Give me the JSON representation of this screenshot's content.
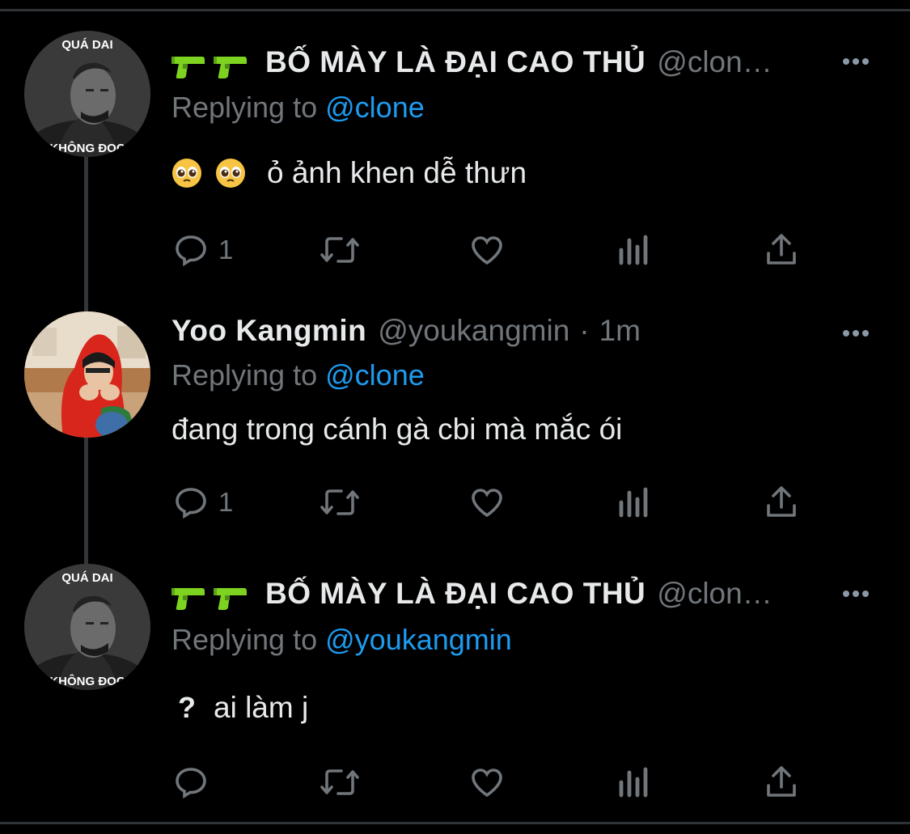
{
  "tweets": [
    {
      "author_name": "BỐ MÀY LÀ ĐẠI CAO THỦ",
      "author_handle": "@clon…",
      "author_emoji": [
        "water-pistol",
        "water-pistol"
      ],
      "avatar_top_text": "QUÁ DAI",
      "avatar_bottom_text": "KHÔNG ĐỌC",
      "replying_label": "Replying to",
      "replying_to": "@clone",
      "body_emoji": [
        "pleading-face",
        "pleading-face"
      ],
      "body": "ỏ ảnh khen dễ thưn",
      "reply_count": "1"
    },
    {
      "author_name": "Yoo Kangmin",
      "author_handle": "@youkangmin",
      "separator": "·",
      "timestamp": "1m",
      "replying_label": "Replying to",
      "replying_to": "@clone",
      "body": "đang trong cánh gà cbi mà mắc ói",
      "reply_count": "1"
    },
    {
      "author_name": "BỐ MÀY LÀ ĐẠI CAO THỦ",
      "author_handle": "@clon…",
      "author_emoji": [
        "water-pistol",
        "water-pistol"
      ],
      "avatar_top_text": "QUÁ DAI",
      "avatar_bottom_text": "KHÔNG ĐỌC",
      "replying_label": "Replying to",
      "replying_to": "@youkangmin",
      "body_prefix": "?",
      "body": "ai làm j",
      "reply_count": ""
    }
  ],
  "colors": {
    "background": "#000000",
    "text": "#e7e9ea",
    "muted": "#71767b",
    "link": "#1d9bf0",
    "thread_line": "#333639"
  }
}
